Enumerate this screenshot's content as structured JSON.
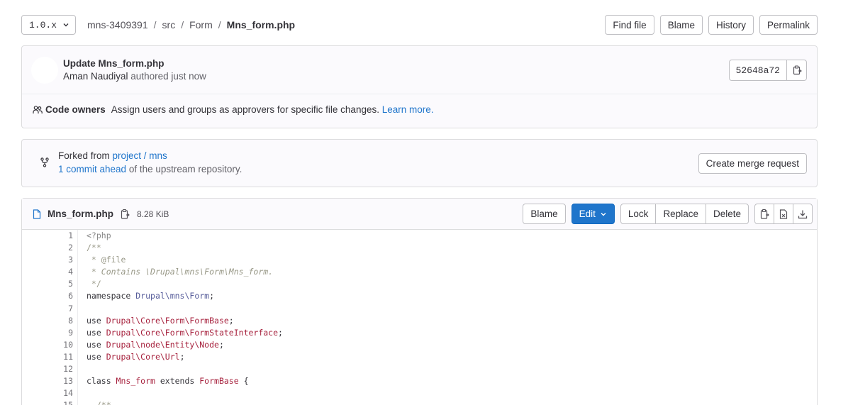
{
  "topbar": {
    "ref": "1.0.x",
    "breadcrumb": [
      "mns-3409391",
      "src",
      "Form",
      "Mns_form.php"
    ],
    "actions": [
      "Find file",
      "Blame",
      "History",
      "Permalink"
    ]
  },
  "commit": {
    "title": "Update Mns_form.php",
    "author": "Aman Naudiyal",
    "meta": " authored just now",
    "sha": "52648a72",
    "code_owners_label": "Code owners",
    "code_owners_text": "Assign users and groups as approvers for specific file changes.",
    "learn_more": "Learn more."
  },
  "fork": {
    "forked_from": "Forked from ",
    "project_link": "project / mns",
    "ahead_link": "1 commit ahead",
    "ahead_text": " of the upstream repository.",
    "mr_button": "Create merge request"
  },
  "file": {
    "name": "Mns_form.php",
    "size": "8.28 KiB",
    "blame": "Blame",
    "edit": "Edit",
    "lock": "Lock",
    "replace": "Replace",
    "delete": "Delete"
  },
  "code": [
    {
      "n": "1",
      "tokens": [
        {
          "t": "<?php",
          "c": "t-meta"
        }
      ]
    },
    {
      "n": "2",
      "tokens": [
        {
          "t": "/**",
          "c": "t-comment"
        }
      ]
    },
    {
      "n": "3",
      "tokens": [
        {
          "t": " * @file",
          "c": "t-comment"
        }
      ]
    },
    {
      "n": "4",
      "tokens": [
        {
          "t": " * ",
          "c": "t-comment"
        },
        {
          "t": "Contains \\Drupal\\mns\\Form\\Mns_form.",
          "c": "t-comment-i"
        }
      ]
    },
    {
      "n": "5",
      "tokens": [
        {
          "t": " */",
          "c": "t-comment"
        }
      ]
    },
    {
      "n": "6",
      "tokens": [
        {
          "t": "namespace ",
          "c": ""
        },
        {
          "t": "Drupal\\mns\\Form",
          "c": "t-ns"
        },
        {
          "t": ";",
          "c": ""
        }
      ]
    },
    {
      "n": "7",
      "tokens": [
        {
          "t": "",
          "c": ""
        }
      ]
    },
    {
      "n": "8",
      "tokens": [
        {
          "t": "use ",
          "c": ""
        },
        {
          "t": "Drupal\\Core\\Form\\FormBase",
          "c": "t-class"
        },
        {
          "t": ";",
          "c": ""
        }
      ]
    },
    {
      "n": "9",
      "tokens": [
        {
          "t": "use ",
          "c": ""
        },
        {
          "t": "Drupal\\Core\\Form\\FormStateInterface",
          "c": "t-class"
        },
        {
          "t": ";",
          "c": ""
        }
      ]
    },
    {
      "n": "10",
      "tokens": [
        {
          "t": "use ",
          "c": ""
        },
        {
          "t": "Drupal\\node\\Entity\\Node",
          "c": "t-class"
        },
        {
          "t": ";",
          "c": ""
        }
      ]
    },
    {
      "n": "11",
      "tokens": [
        {
          "t": "use ",
          "c": ""
        },
        {
          "t": "Drupal\\Core\\Url",
          "c": "t-class"
        },
        {
          "t": ";",
          "c": ""
        }
      ]
    },
    {
      "n": "12",
      "tokens": [
        {
          "t": "",
          "c": ""
        }
      ]
    },
    {
      "n": "13",
      "tokens": [
        {
          "t": "class ",
          "c": ""
        },
        {
          "t": "Mns_form",
          "c": "t-class"
        },
        {
          "t": " extends ",
          "c": ""
        },
        {
          "t": "FormBase",
          "c": "t-class"
        },
        {
          "t": " {",
          "c": ""
        }
      ]
    },
    {
      "n": "14",
      "tokens": [
        {
          "t": "",
          "c": ""
        }
      ]
    },
    {
      "n": "15",
      "tokens": [
        {
          "t": "  /**",
          "c": "t-comment"
        }
      ]
    }
  ]
}
